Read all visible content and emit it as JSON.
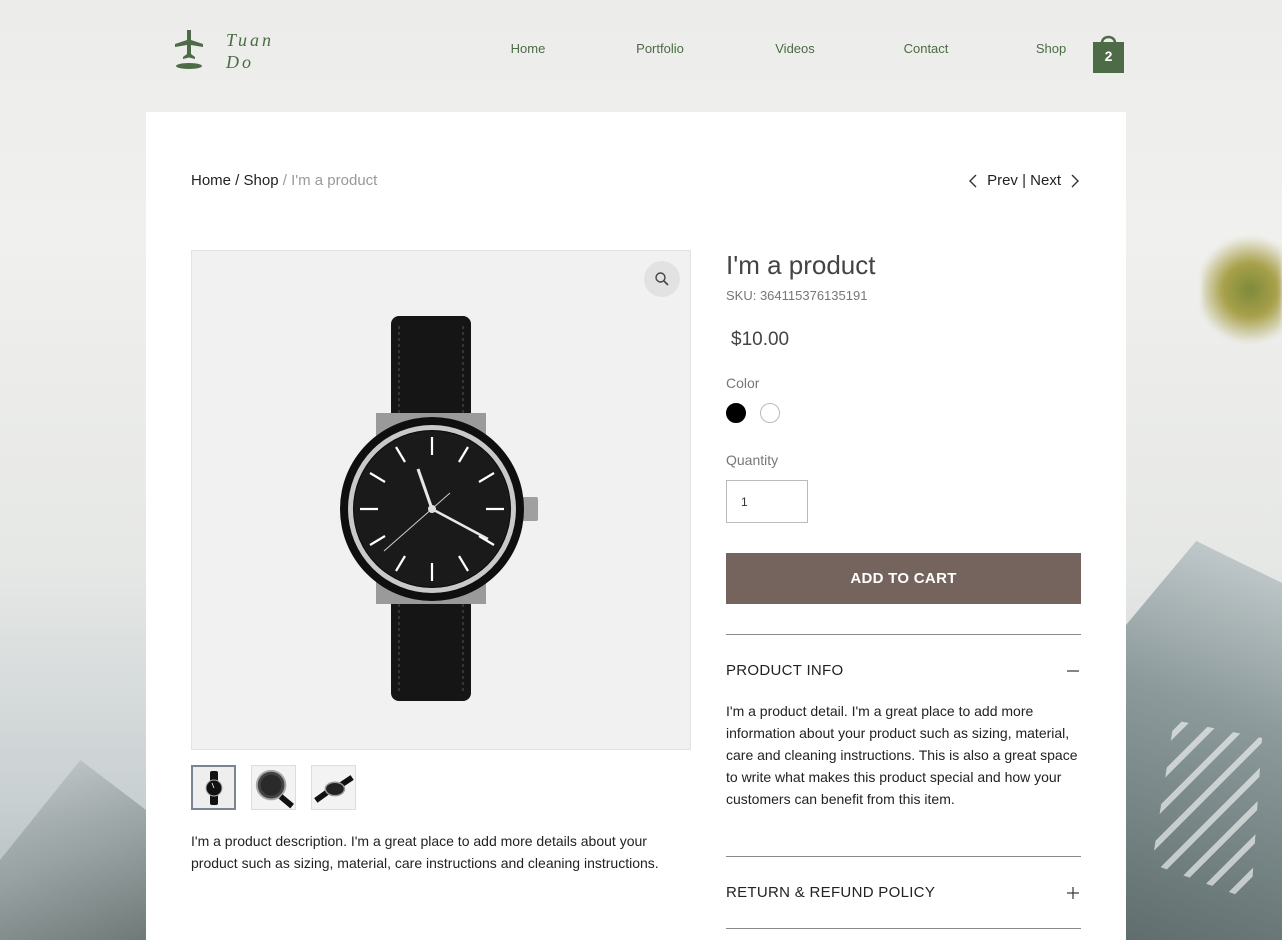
{
  "brand": {
    "line1": "Tuan",
    "line2": "Do"
  },
  "nav": {
    "items": [
      {
        "label": "Home"
      },
      {
        "label": "Portfolio"
      },
      {
        "label": "Videos"
      },
      {
        "label": "Contact"
      },
      {
        "label": "Shop"
      }
    ],
    "cart_count": "2"
  },
  "breadcrumb": {
    "home": "Home",
    "sep1": " / ",
    "shop": "Shop",
    "sep2": " / ",
    "current": "I'm a product"
  },
  "pager": {
    "prev": "Prev",
    "sep": " | ",
    "next": "Next"
  },
  "product": {
    "title": "I'm a product",
    "sku": "SKU: 364115376135191",
    "price": "$10.00",
    "color_label": "Color",
    "colors": [
      "#000000",
      "#ffffff"
    ],
    "quantity_label": "Quantity",
    "quantity_value": "1",
    "add_to_cart": "ADD TO CART",
    "description": "I'm a product description. I'm a great place to add more details about your product such as sizing, material, care instructions and cleaning instructions."
  },
  "accordion": [
    {
      "title": "PRODUCT INFO",
      "toggle": "−",
      "expanded": true,
      "body": "I'm a product detail. I'm a great place to add more information about your product such as sizing, material, care and cleaning instructions. This is also a great space to write what makes this product special and how your customers can benefit from this item."
    },
    {
      "title": "RETURN & REFUND POLICY",
      "toggle": "+",
      "expanded": false
    }
  ],
  "colors": {
    "brand_green": "#4d6b46",
    "button_brown": "#74645d"
  }
}
